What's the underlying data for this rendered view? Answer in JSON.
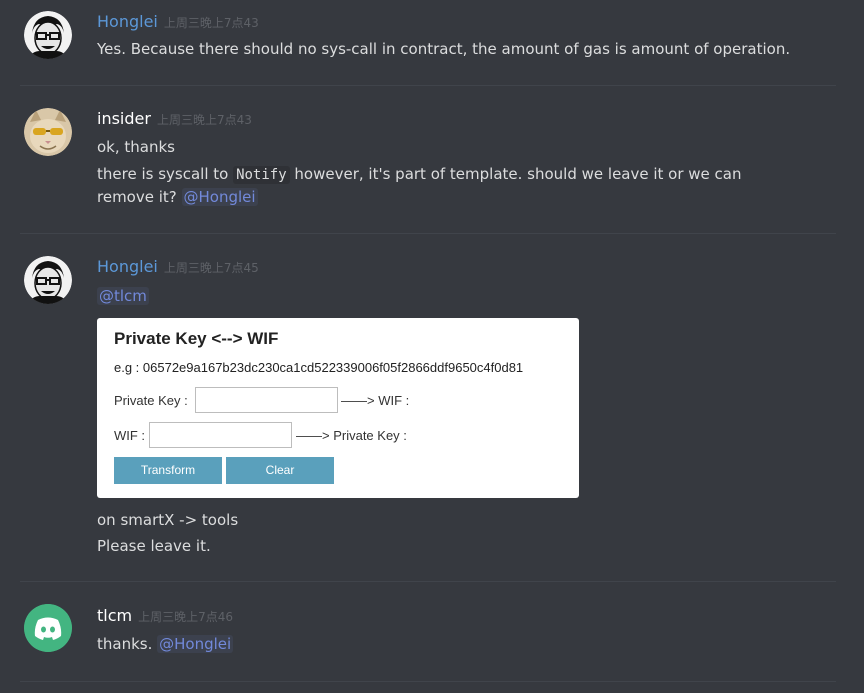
{
  "colors": {
    "background": "#36393f",
    "author_blue": "#5c98d8",
    "mention": "#7289da",
    "discord_green": "#43b581",
    "button": "#5aa0bc"
  },
  "messages": [
    {
      "author": "Honglei",
      "timestamp": "上周三晚上7点43",
      "avatar": "portrait-icon",
      "lines": [
        "Yes.   Because there should no sys-call in contract, the amount of gas is amount of operation."
      ]
    },
    {
      "author": "insider",
      "timestamp": "上周三晚上7点43",
      "avatar": "cat-sunglasses-icon",
      "line1": "ok, thanks",
      "line2_pre": "there is syscall to ",
      "line2_code": "Notify",
      "line2_post": " however, it's part of template. should we leave it or we can",
      "line3_pre": "remove it? ",
      "line3_mention": "@Honglei"
    },
    {
      "author": "Honglei",
      "timestamp": "上周三晚上7点45",
      "avatar": "portrait-icon",
      "mention": "@tlcm",
      "embed": {
        "title": "Private Key <--> WIF",
        "example": "e.g : 06572e9a167b23dc230ca1cd522339006f05f2866ddf9650c4f0d81",
        "private_key_label": "Private Key :",
        "arrow_wif": "——> WIF :",
        "wif_label": "WIF :",
        "arrow_private_key": "——> Private Key :",
        "transform_button": "Transform",
        "clear_button": "Clear"
      },
      "after_lines": [
        "on smartX -> tools",
        "Please leave it."
      ]
    },
    {
      "author": "tlcm",
      "timestamp": "上周三晚上7点46",
      "avatar": "discord-logo-icon",
      "line_pre": "thanks. ",
      "line_mention": "@Honglei"
    }
  ]
}
